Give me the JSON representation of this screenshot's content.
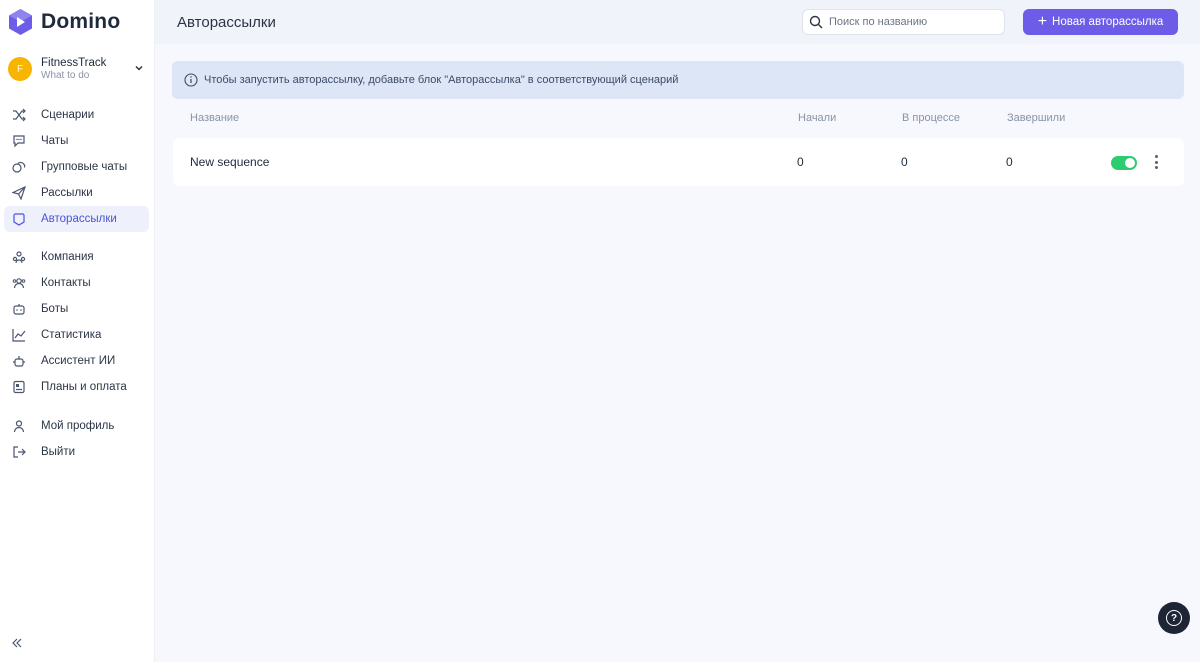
{
  "app": {
    "name": "Domino",
    "accent": "#6c5ce7"
  },
  "workspace": {
    "avatar_letter": "F",
    "name": "FitnessTrack",
    "subtitle": "What to do"
  },
  "sidebar": {
    "items": [
      {
        "label": "Сценарии",
        "icon": "shuffle-icon"
      },
      {
        "label": "Чаты",
        "icon": "chat-icon"
      },
      {
        "label": "Групповые чаты",
        "icon": "group-chat-icon"
      },
      {
        "label": "Рассылки",
        "icon": "send-icon"
      },
      {
        "label": "Авторассылки",
        "icon": "auto-send-icon",
        "active": true
      },
      {
        "label": "Компания",
        "icon": "company-icon"
      },
      {
        "label": "Контакты",
        "icon": "contacts-icon"
      },
      {
        "label": "Боты",
        "icon": "bot-icon"
      },
      {
        "label": "Статистика",
        "icon": "chart-icon"
      },
      {
        "label": "Ассистент ИИ",
        "icon": "ai-assistant-icon"
      },
      {
        "label": "Планы и оплата",
        "icon": "billing-icon"
      },
      {
        "label": "Мой профиль",
        "icon": "user-icon"
      },
      {
        "label": "Выйти",
        "icon": "logout-icon"
      }
    ]
  },
  "header": {
    "title": "Авторассылки",
    "search_placeholder": "Поиск по названию",
    "new_button_label": "Новая авторассылка"
  },
  "info_banner": "Чтобы запустить авторассылку, добавьте блок \"Авторассылка\" в соответствующий сценарий",
  "table": {
    "columns": [
      "Название",
      "Начали",
      "В процессе",
      "Завершили"
    ],
    "rows": [
      {
        "name": "New sequence",
        "started": "0",
        "in_progress": "0",
        "finished": "0",
        "enabled": true
      }
    ]
  }
}
